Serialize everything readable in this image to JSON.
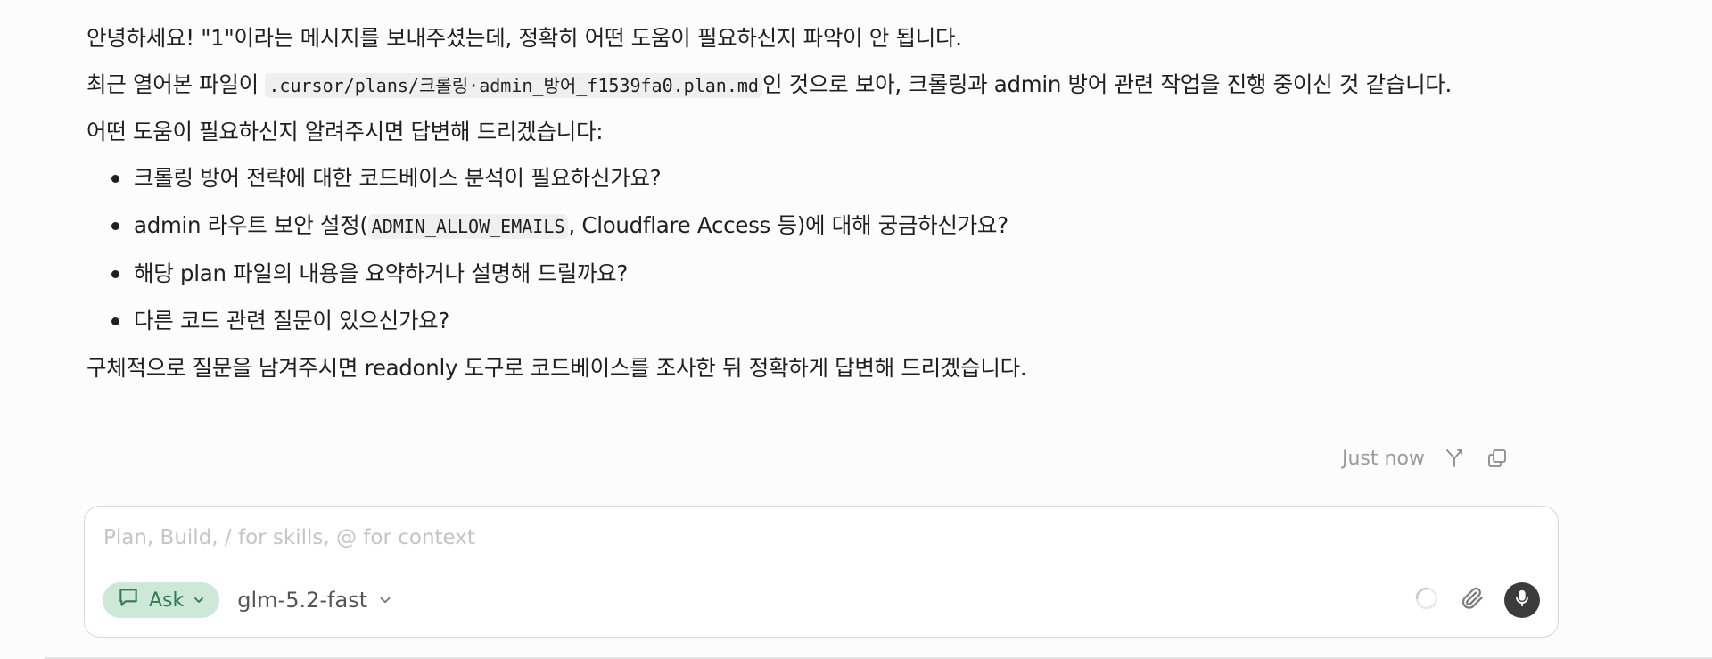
{
  "message": {
    "greeting": "안녕하세요! \"1\"이라는 메시지를 보내주셨는데, 정확히 어떤 도움이 필요하신지 파악이 안 됩니다.",
    "recent_prefix": "최근 열어본 파일이 ",
    "recent_file": ".cursor/plans/크롤링·admin_방어_f1539fa0.plan.md",
    "recent_suffix": "인 것으로 보아, 크롤링과 admin 방어 관련 작업을 진행 중이신 것 같습니다.",
    "intro": "어떤 도움이 필요하신지 알려주시면 답변해 드리겠습니다:",
    "items": {
      "i0": "크롤링 방어 전략에 대한 코드베이스 분석이 필요하신가요?",
      "i1_prefix": "admin 라우트 보안 설정(",
      "i1_code": "ADMIN_ALLOW_EMAILS",
      "i1_suffix": ", Cloudflare Access 등)에 대해 궁금하신가요?",
      "i2": "해당 plan 파일의 내용을 요약하거나 설명해 드릴까요?",
      "i3": "다른 코드 관련 질문이 있으신가요?"
    },
    "closing": "구체적으로 질문을 남겨주시면 readonly 도구로 코드베이스를 조사한 뒤 정확하게 답변해 드리겠습니다."
  },
  "meta": {
    "timestamp": "Just now",
    "fork_icon": "branch-icon",
    "copy_icon": "copy-icon"
  },
  "composer": {
    "placeholder": "Plan, Build, / for skills, @ for context",
    "mode_label": "Ask",
    "mode_icon": "chat-bubble-icon",
    "model_label": "glm-5.2-fast",
    "accent_color": "#2e7d4f",
    "pill_bg": "#cde7d8"
  }
}
